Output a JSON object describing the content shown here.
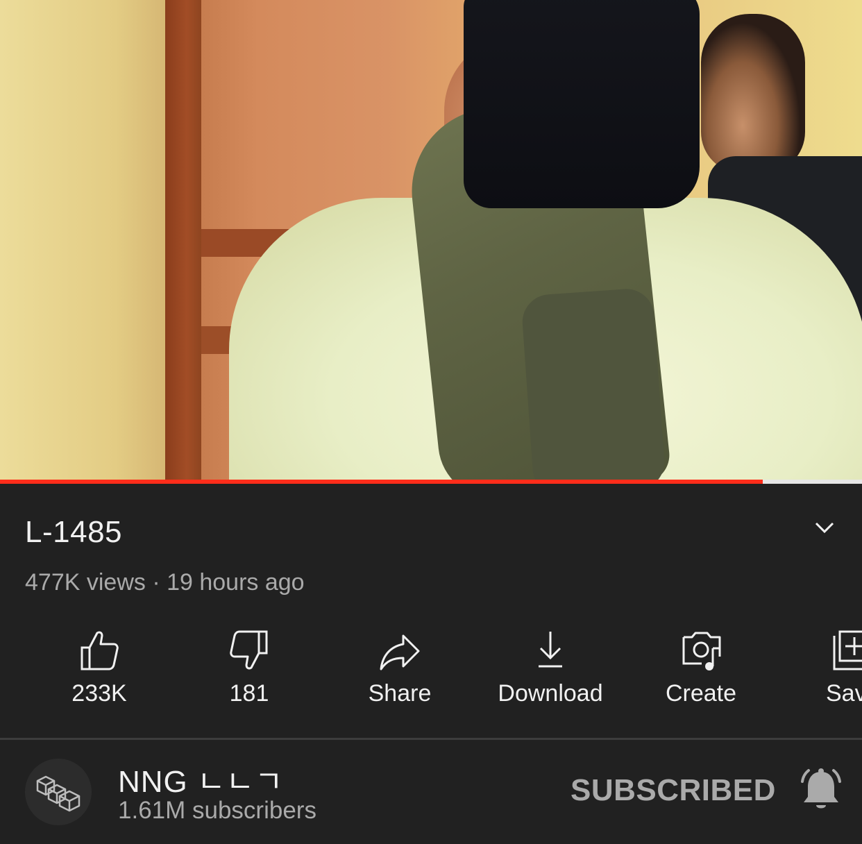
{
  "player": {
    "progress_fraction": 0.885,
    "accent_color": "#ff2d1a"
  },
  "video": {
    "title": "L-1485",
    "meta": "477K views · 19 hours ago",
    "expand_icon": "chevron-down-icon"
  },
  "actions": [
    {
      "icon": "thumbs-up-icon",
      "label": "233K"
    },
    {
      "icon": "thumbs-down-icon",
      "label": "181"
    },
    {
      "icon": "share-icon",
      "label": "Share"
    },
    {
      "icon": "download-icon",
      "label": "Download"
    },
    {
      "icon": "create-icon",
      "label": "Create"
    },
    {
      "icon": "save-to-playlist-icon",
      "label": "Sav"
    }
  ],
  "channel": {
    "name": "NNG ㄴㄴㄱ",
    "subscribers": "1.61M subscribers",
    "subscribe_state": "SUBSCRIBED",
    "bell_icon": "bell-icon"
  }
}
